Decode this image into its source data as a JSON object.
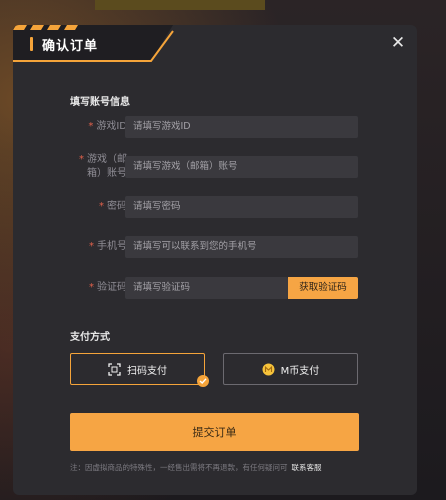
{
  "modal": {
    "title": "确认订单",
    "close_glyph": "✕"
  },
  "account_section": {
    "title": "填写账号信息",
    "fields": [
      {
        "label": "游戏ID",
        "placeholder": "请填写游戏ID"
      },
      {
        "label": "游戏（邮箱）账号",
        "placeholder": "请填写游戏（邮箱）账号"
      },
      {
        "label": "密码",
        "placeholder": "请填写密码"
      },
      {
        "label": "手机号",
        "placeholder": "请填写可以联系到您的手机号"
      },
      {
        "label": "验证码",
        "placeholder": "请填写验证码"
      }
    ],
    "get_code_label": "获取验证码"
  },
  "payment": {
    "title": "支付方式",
    "options": [
      {
        "label": "扫码支付",
        "icon": "scan-icon",
        "selected": true
      },
      {
        "label": "M币支付",
        "icon": "m-coin-icon",
        "selected": false
      }
    ]
  },
  "submit_label": "提交订单",
  "notice": {
    "text": "注：因虚拟商品的特殊性，一经售出需将不再退款，有任何疑问可",
    "link": "联系客服"
  },
  "colors": {
    "accent": "#f5a43a",
    "panel": "#2c2b2f",
    "input_bg": "#3a393e",
    "required": "#e0614b"
  }
}
